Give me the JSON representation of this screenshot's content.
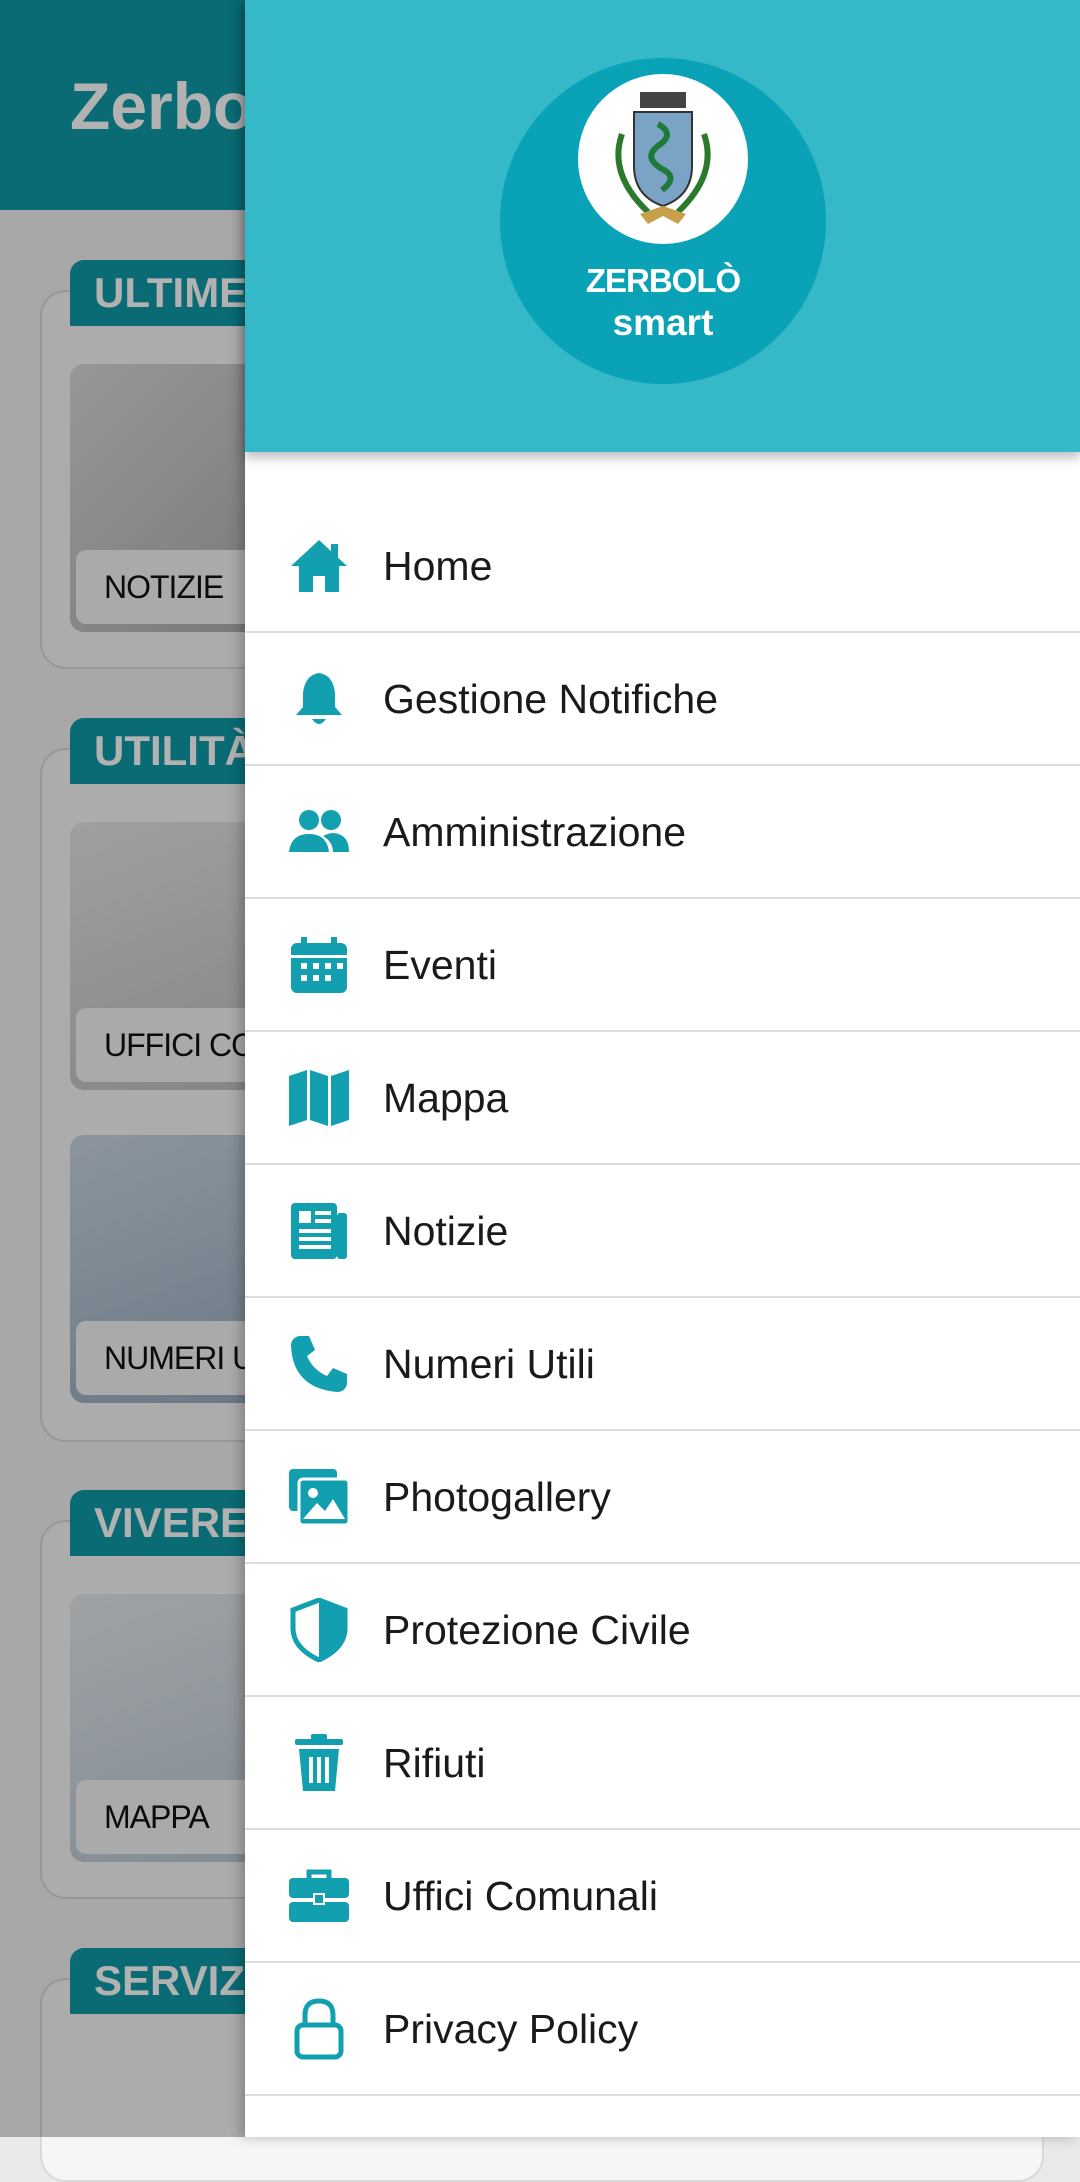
{
  "app": {
    "title": "Zerbolò",
    "sections": [
      {
        "tag": "ULTIME NOTIZIE",
        "tiles": [
          {
            "caption": "NOTIZIE"
          }
        ]
      },
      {
        "tag": "UTILITÀ",
        "tiles": [
          {
            "caption": "UFFICI COMUNALI"
          },
          {
            "caption": "NUMERI UTILI"
          }
        ]
      },
      {
        "tag": "VIVERE",
        "tiles": [
          {
            "caption": "MAPPA"
          }
        ]
      },
      {
        "tag": "SERVIZI",
        "tiles": []
      }
    ]
  },
  "drawer": {
    "logo": {
      "line1": "ZERBOLÒ",
      "line2": "smart"
    },
    "items": [
      {
        "label": "Home",
        "icon": "home-icon"
      },
      {
        "label": "Gestione Notifiche",
        "icon": "bell-icon"
      },
      {
        "label": "Amministrazione",
        "icon": "people-icon"
      },
      {
        "label": "Eventi",
        "icon": "calendar-icon"
      },
      {
        "label": "Mappa",
        "icon": "map-icon"
      },
      {
        "label": "Notizie",
        "icon": "newspaper-icon"
      },
      {
        "label": "Numeri Utili",
        "icon": "phone-icon"
      },
      {
        "label": "Photogallery",
        "icon": "photos-icon"
      },
      {
        "label": "Protezione Civile",
        "icon": "shield-icon"
      },
      {
        "label": "Rifiuti",
        "icon": "trash-icon"
      },
      {
        "label": "Uffici Comunali",
        "icon": "briefcase-icon"
      },
      {
        "label": "Privacy Policy",
        "icon": "lock-icon"
      }
    ]
  },
  "colors": {
    "accent": "#0f9aa8",
    "header": "#35b8c7",
    "icon": "#129fb0"
  }
}
